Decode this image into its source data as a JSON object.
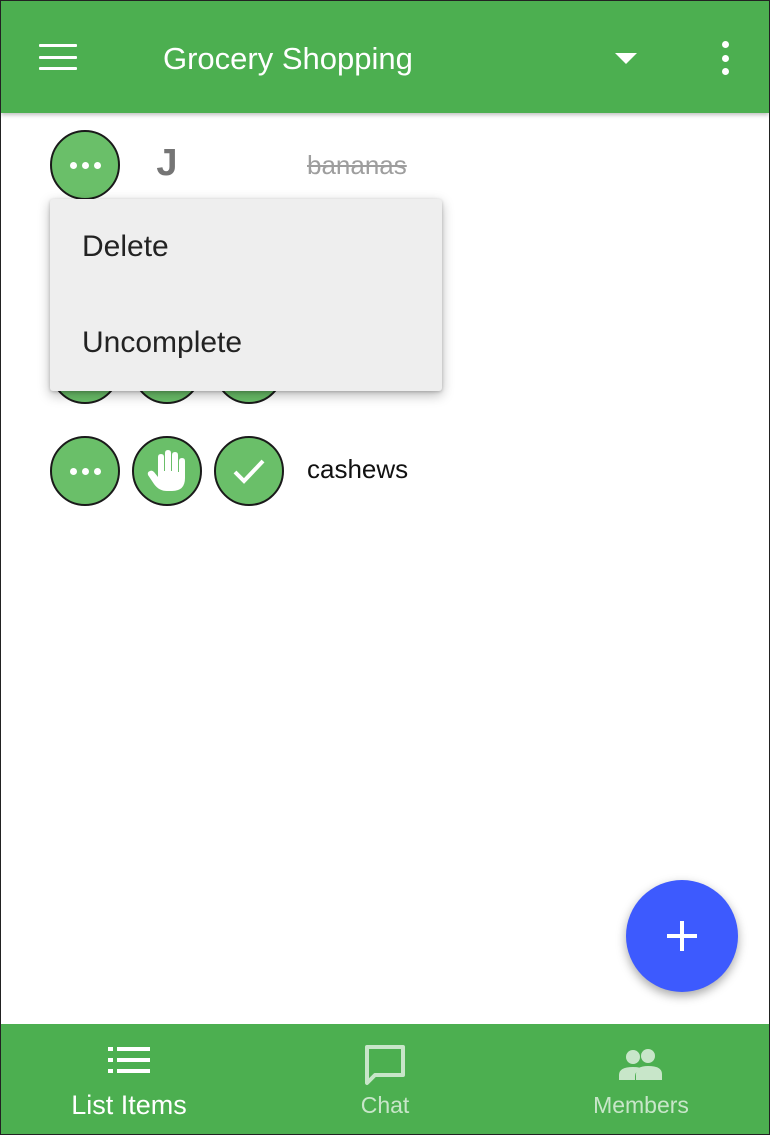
{
  "app_bar": {
    "title": "Grocery Shopping",
    "menu_icon": "hamburger-menu-icon",
    "dropdown_icon": "arrow-drop-down-icon",
    "more_icon": "more-vert-icon"
  },
  "items": [
    {
      "initial": "J",
      "text": "bananas",
      "completed": true
    },
    {
      "initial": "",
      "text": "",
      "completed": false
    },
    {
      "initial": "",
      "text": "cashews",
      "completed": false
    }
  ],
  "context_menu": {
    "delete_label": "Delete",
    "uncomplete_label": "Uncomplete"
  },
  "fab": {
    "icon": "add-icon"
  },
  "bottom_nav": {
    "list_items_label": "List Items",
    "chat_label": "Chat",
    "members_label": "Members",
    "active": "List Items"
  },
  "colors": {
    "primary": "#4caf50",
    "button_green": "#6abf69",
    "fab": "#3d5afe",
    "menu_bg": "#eeeeee"
  }
}
